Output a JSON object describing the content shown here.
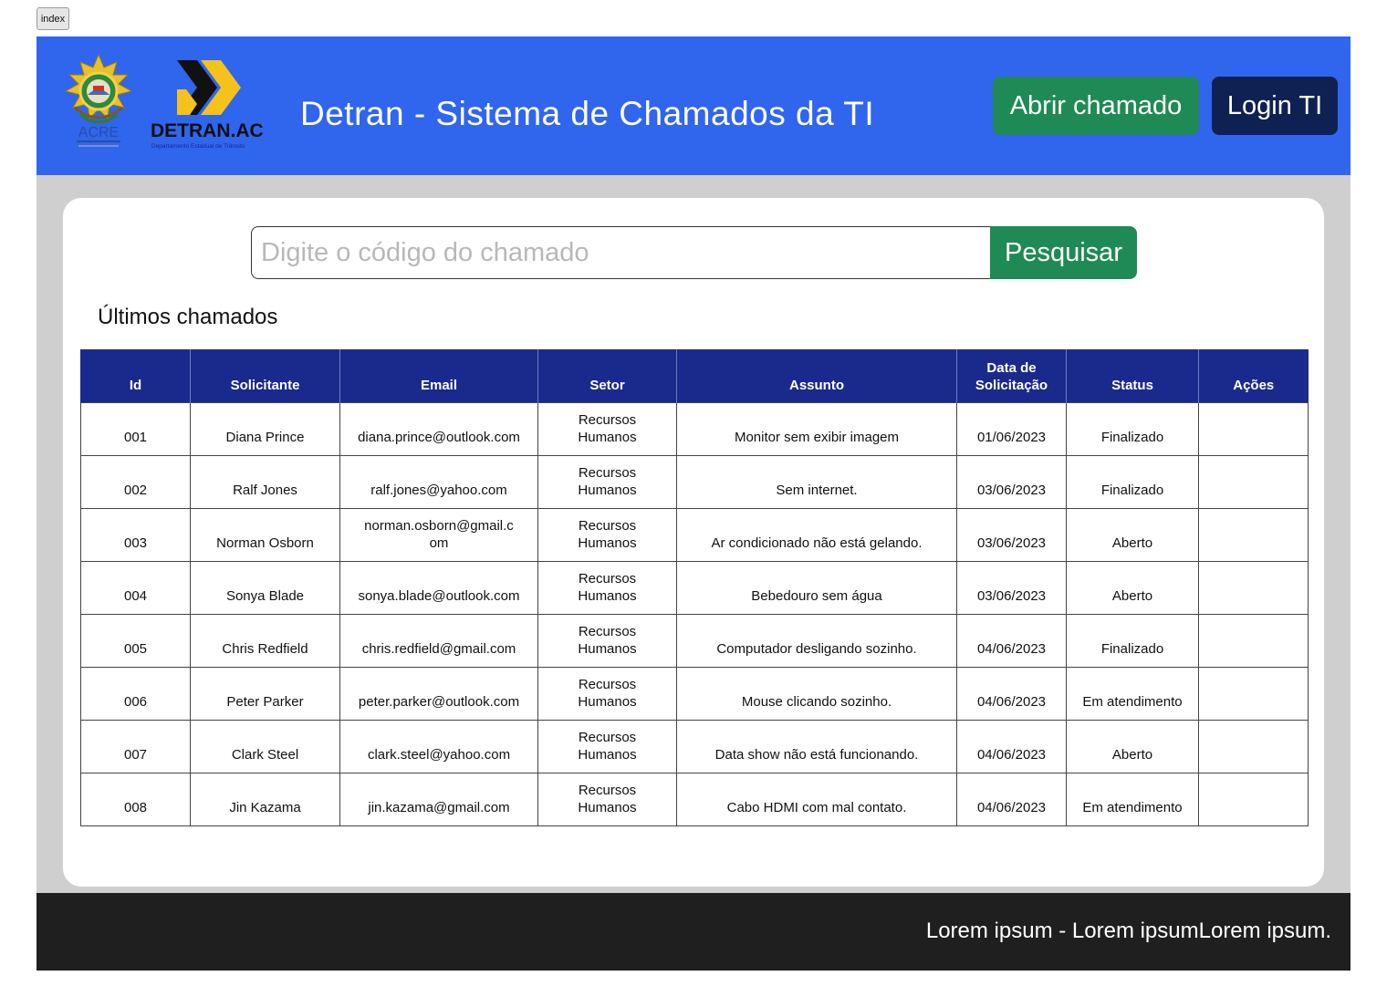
{
  "page_tag": "index",
  "header": {
    "title": "Detran - Sistema de Chamados da TI",
    "open_ticket_label": "Abrir chamado",
    "login_label": "Login TI",
    "acre_logo_text": "ACRE",
    "detran_logo_text": "DETRAN.AC",
    "detran_logo_subtitle": "Departamento Estadual de Trânsito",
    "colors": {
      "header_bg": "#3065ee",
      "open_button": "#1f8a55",
      "login_button": "#0f2152"
    }
  },
  "search": {
    "placeholder": "Digite o código do chamado",
    "button_label": "Pesquisar"
  },
  "section_title": "Últimos chamados",
  "table": {
    "header_color": "#1a2a8c",
    "columns": [
      "Id",
      "Solicitante",
      "Email",
      "Setor",
      "Assunto",
      "Data de Solicitação",
      "Status",
      "Ações"
    ],
    "rows": [
      {
        "id": "001",
        "solicitante": "Diana Prince",
        "email": "diana.prince@outlook.com",
        "setor": "Recursos Humanos",
        "assunto": "Monitor sem exibir imagem",
        "data": "01/06/2023",
        "status": "Finalizado",
        "acoes": ""
      },
      {
        "id": "002",
        "solicitante": "Ralf Jones",
        "email": "ralf.jones@yahoo.com",
        "setor": "Recursos Humanos",
        "assunto": "Sem internet.",
        "data": "03/06/2023",
        "status": "Finalizado",
        "acoes": ""
      },
      {
        "id": "003",
        "solicitante": "Norman Osborn",
        "email": "norman.osborn@gmail.com",
        "setor": "Recursos Humanos",
        "assunto": "Ar condicionado não está gelando.",
        "data": "03/06/2023",
        "status": "Aberto",
        "acoes": ""
      },
      {
        "id": "004",
        "solicitante": "Sonya Blade",
        "email": "sonya.blade@outlook.com",
        "setor": "Recursos Humanos",
        "assunto": "Bebedouro sem água",
        "data": "03/06/2023",
        "status": "Aberto",
        "acoes": ""
      },
      {
        "id": "005",
        "solicitante": "Chris Redfield",
        "email": "chris.redfield@gmail.com",
        "setor": "Recursos Humanos",
        "assunto": "Computador desligando sozinho.",
        "data": "04/06/2023",
        "status": "Finalizado",
        "acoes": ""
      },
      {
        "id": "006",
        "solicitante": "Peter Parker",
        "email": "peter.parker@outlook.com",
        "setor": "Recursos Humanos",
        "assunto": "Mouse clicando sozinho.",
        "data": "04/06/2023",
        "status": "Em atendimento",
        "acoes": ""
      },
      {
        "id": "007",
        "solicitante": "Clark Steel",
        "email": "clark.steel@yahoo.com",
        "setor": "Recursos Humanos",
        "assunto": "Data show não está funcionando.",
        "data": "04/06/2023",
        "status": "Aberto",
        "acoes": ""
      },
      {
        "id": "008",
        "solicitante": "Jin Kazama",
        "email": "jin.kazama@gmail.com",
        "setor": "Recursos Humanos",
        "assunto": "Cabo HDMI com mal contato.",
        "data": "04/06/2023",
        "status": "Em atendimento",
        "acoes": ""
      }
    ]
  },
  "footer": {
    "text": "Lorem ipsum - Lorem ipsumLorem ipsum."
  }
}
